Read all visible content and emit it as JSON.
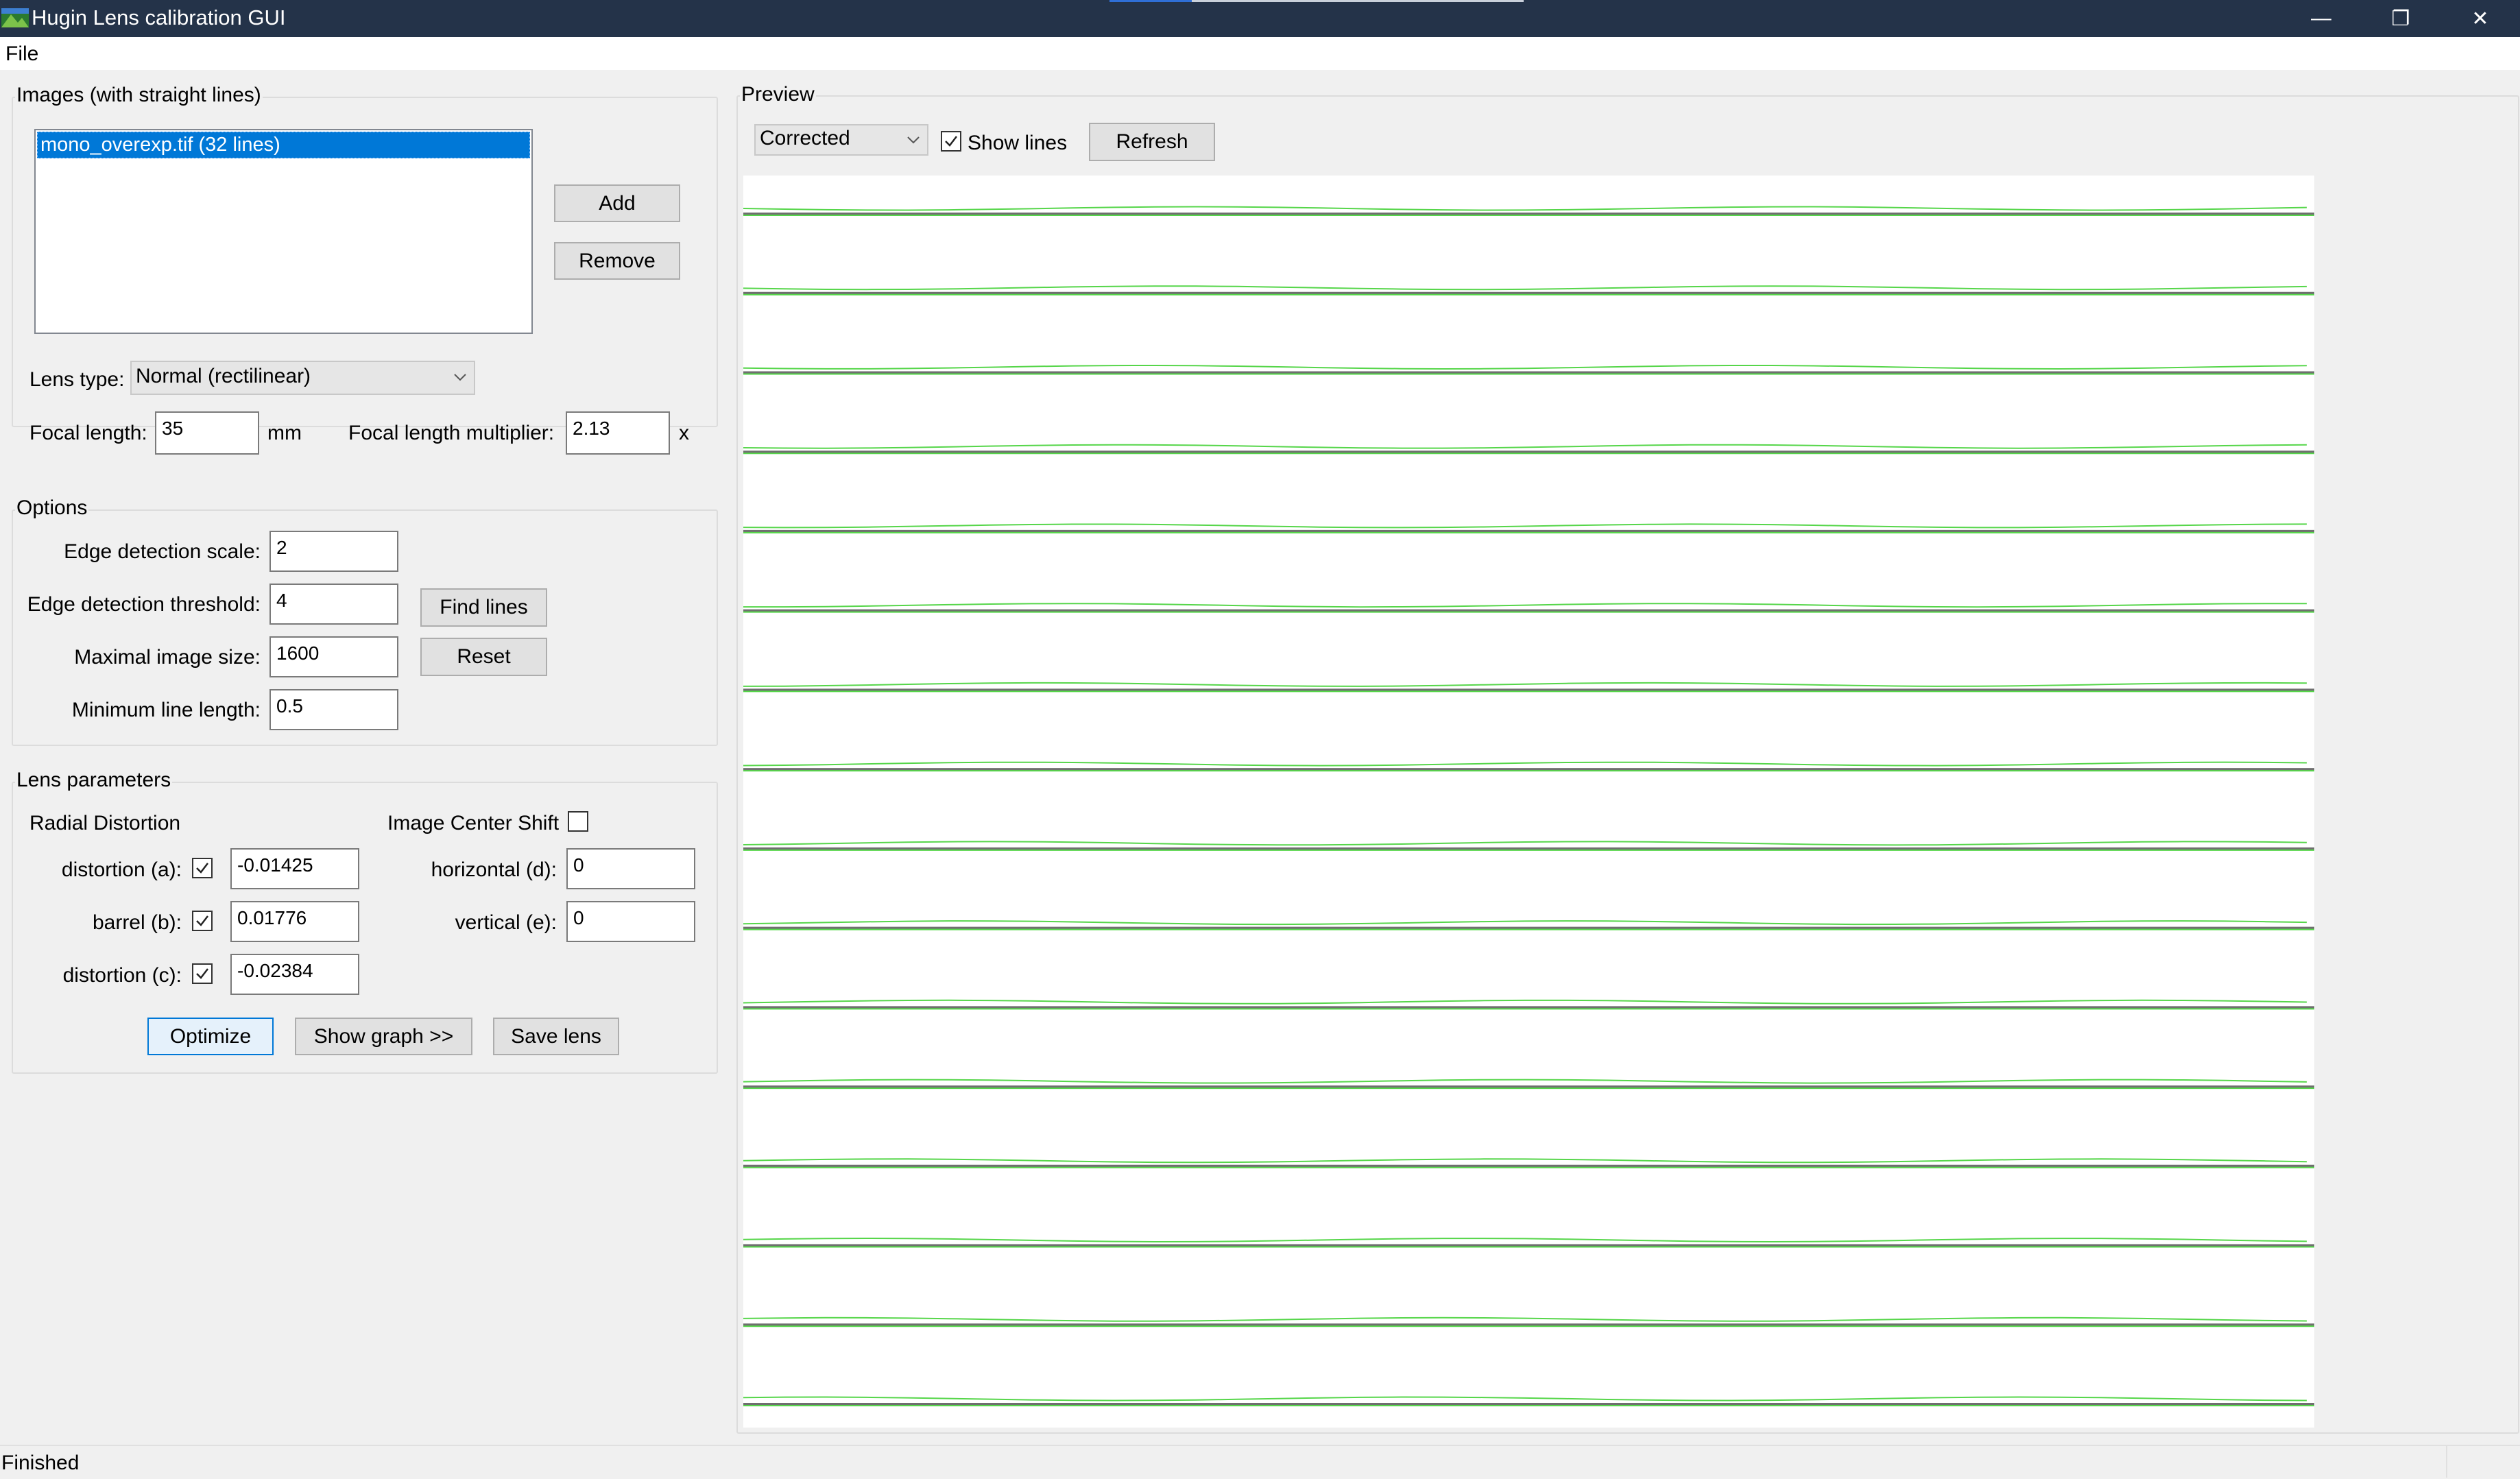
{
  "window": {
    "title": "Hugin Lens calibration GUI",
    "minimize_glyph": "—",
    "restore_glyph": "❐",
    "close_glyph": "✕"
  },
  "menu": {
    "file_label": "File"
  },
  "images_group": {
    "title": "Images (with straight lines)",
    "list_items": [
      "mono_overexp.tif (32 lines)"
    ],
    "add_label": "Add",
    "remove_label": "Remove",
    "lens_type_label": "Lens type:",
    "lens_type_value": "Normal (rectilinear)",
    "focal_length_label": "Focal length:",
    "focal_length_value": "35",
    "focal_length_unit": "mm",
    "multiplier_label": "Focal length multiplier:",
    "multiplier_value": "2.13",
    "multiplier_unit": "x"
  },
  "options_group": {
    "title": "Options",
    "edge_scale_label": "Edge detection scale:",
    "edge_scale_value": "2",
    "edge_threshold_label": "Edge detection threshold:",
    "edge_threshold_value": "4",
    "max_size_label": "Maximal image size:",
    "max_size_value": "1600",
    "min_line_label": "Minimum line length:",
    "min_line_value": "0.5",
    "find_lines_label": "Find lines",
    "reset_label": "Reset"
  },
  "lens_group": {
    "title": "Lens parameters",
    "radial_label": "Radial Distortion",
    "center_shift_label": "Image Center Shift",
    "center_shift_checked": false,
    "distortion_a_label": "distortion (a):",
    "distortion_a_value": "-0.01425",
    "distortion_a_checked": true,
    "barrel_b_label": "barrel (b):",
    "barrel_b_value": "0.01776",
    "barrel_b_checked": true,
    "distortion_c_label": "distortion (c):",
    "distortion_c_value": "-0.02384",
    "distortion_c_checked": true,
    "horizontal_d_label": "horizontal (d):",
    "horizontal_d_value": "0",
    "vertical_e_label": "vertical (e):",
    "vertical_e_value": "0",
    "optimize_label": "Optimize",
    "show_graph_label": "Show graph >>",
    "save_lens_label": "Save lens"
  },
  "preview": {
    "title": "Preview",
    "mode_value": "Corrected",
    "show_lines_label": "Show lines",
    "show_lines_checked": true,
    "refresh_label": "Refresh",
    "line_count": 16,
    "line_color": "#56d64a",
    "image_line_color": "#6f6f6f"
  },
  "status": {
    "text": "Finished"
  },
  "colors": {
    "titlebar": "#243349",
    "selection": "#0078d7",
    "focus_border": "#0078d7"
  }
}
